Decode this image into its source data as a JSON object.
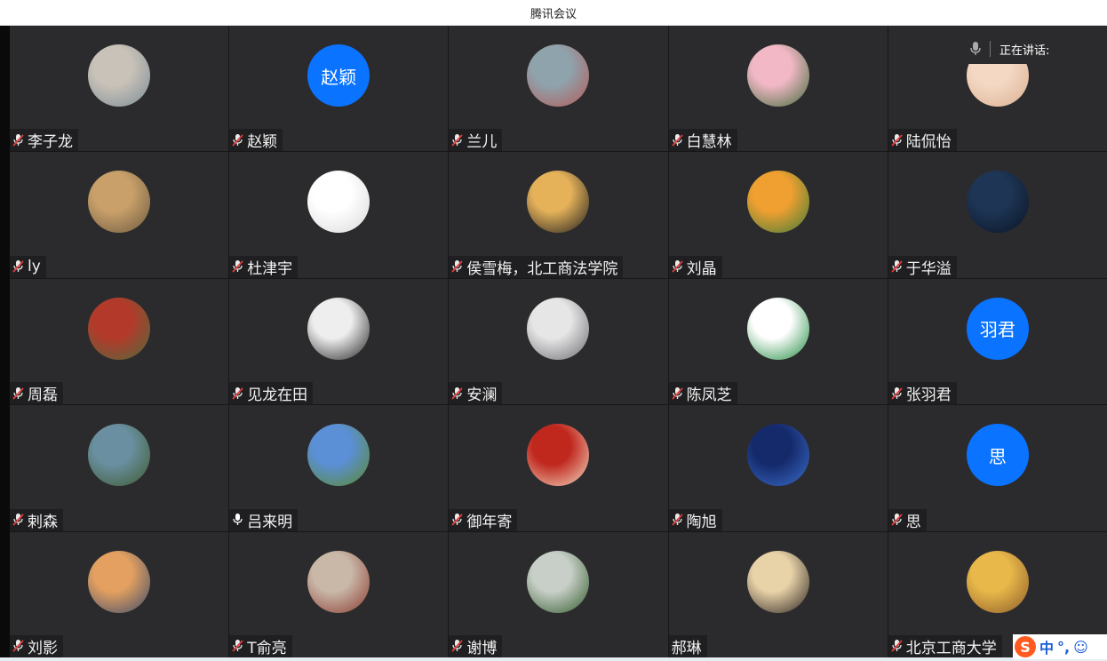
{
  "window": {
    "title": "腾讯会议"
  },
  "speaking": {
    "label": "正在讲话:"
  },
  "participants": [
    {
      "name": "李子龙",
      "mic": "muted",
      "avatar": {
        "kind": "photo",
        "colors": [
          "#c9c2b8",
          "#7b8c96"
        ]
      }
    },
    {
      "name": "赵颖",
      "mic": "muted",
      "avatar": {
        "kind": "text",
        "text": "赵颖"
      }
    },
    {
      "name": "兰儿",
      "mic": "muted",
      "avatar": {
        "kind": "photo",
        "colors": [
          "#8fa3ad",
          "#b35a55"
        ]
      }
    },
    {
      "name": "白慧林",
      "mic": "muted",
      "avatar": {
        "kind": "photo",
        "colors": [
          "#f2b8c6",
          "#3f6b3a"
        ]
      }
    },
    {
      "name": "陆侃怡",
      "mic": "muted",
      "avatar": {
        "kind": "photo",
        "colors": [
          "#f4d8c4",
          "#d9b090"
        ]
      }
    },
    {
      "name": "ly",
      "mic": "muted",
      "avatar": {
        "kind": "photo",
        "colors": [
          "#c9a06a",
          "#6b5a40"
        ]
      }
    },
    {
      "name": "杜津宇",
      "mic": "muted",
      "avatar": {
        "kind": "photo",
        "colors": [
          "#ffffff",
          "#d9d9d9"
        ]
      }
    },
    {
      "name": "侯雪梅，北工商法学院",
      "mic": "muted",
      "avatar": {
        "kind": "photo",
        "colors": [
          "#e5b25a",
          "#1c1c1c"
        ]
      }
    },
    {
      "name": "刘晶",
      "mic": "muted",
      "avatar": {
        "kind": "photo",
        "colors": [
          "#f0a030",
          "#3c7a3a"
        ]
      }
    },
    {
      "name": "于华溢",
      "mic": "muted",
      "avatar": {
        "kind": "photo",
        "colors": [
          "#1e3555",
          "#0a1424"
        ]
      }
    },
    {
      "name": "周磊",
      "mic": "muted",
      "avatar": {
        "kind": "photo",
        "colors": [
          "#b33a2a",
          "#4f6b3d"
        ]
      }
    },
    {
      "name": "见龙在田",
      "mic": "muted",
      "avatar": {
        "kind": "photo",
        "colors": [
          "#eeeeee",
          "#222222"
        ]
      }
    },
    {
      "name": "安澜",
      "mic": "muted",
      "avatar": {
        "kind": "photo",
        "colors": [
          "#e6e6e6",
          "#6a6a70"
        ]
      }
    },
    {
      "name": "陈凤芝",
      "mic": "muted",
      "avatar": {
        "kind": "photo",
        "colors": [
          "#ffffff",
          "#1d8a3c"
        ]
      }
    },
    {
      "name": "张羽君",
      "mic": "muted",
      "avatar": {
        "kind": "text",
        "text": "羽君"
      }
    },
    {
      "name": "剌森",
      "mic": "muted",
      "avatar": {
        "kind": "photo",
        "colors": [
          "#6a8fa0",
          "#3e5a2e"
        ]
      }
    },
    {
      "name": "吕来明",
      "mic": "on",
      "avatar": {
        "kind": "photo",
        "colors": [
          "#5b8fd6",
          "#5a8a2a"
        ]
      }
    },
    {
      "name": "御年寄",
      "mic": "muted",
      "avatar": {
        "kind": "photo",
        "colors": [
          "#c0281e",
          "#f3dcc4"
        ]
      }
    },
    {
      "name": "陶旭",
      "mic": "muted",
      "avatar": {
        "kind": "photo",
        "colors": [
          "#152a6b",
          "#3a6dcc"
        ]
      }
    },
    {
      "name": "思",
      "mic": "muted",
      "avatar": {
        "kind": "text",
        "text": "思"
      }
    },
    {
      "name": "刘影",
      "mic": "muted",
      "avatar": {
        "kind": "photo",
        "colors": [
          "#e3a060",
          "#3a4a6b"
        ]
      }
    },
    {
      "name": "T俞亮",
      "mic": "muted",
      "avatar": {
        "kind": "photo",
        "colors": [
          "#c9b8a8",
          "#8a3a30"
        ]
      }
    },
    {
      "name": "谢博",
      "mic": "muted",
      "avatar": {
        "kind": "photo",
        "colors": [
          "#c8cfc8",
          "#2f5a2a"
        ]
      }
    },
    {
      "name": "郝琳",
      "mic": "none",
      "avatar": {
        "kind": "photo",
        "colors": [
          "#e8d2a8",
          "#2a2320"
        ]
      }
    },
    {
      "name": "北京工商大学",
      "mic": "muted",
      "avatar": {
        "kind": "photo",
        "colors": [
          "#e8b84a",
          "#8a5a2a"
        ]
      }
    }
  ],
  "ime": {
    "logo": "S",
    "mode": "中",
    "punct": "°,",
    "emoji": "☺"
  }
}
